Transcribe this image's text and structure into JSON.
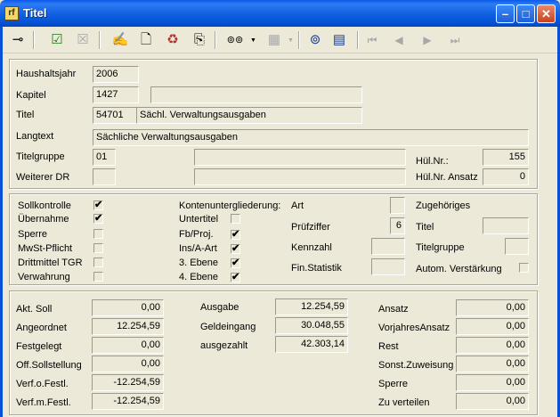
{
  "window": {
    "title": "Titel",
    "icon_text": "rf"
  },
  "toolbar": {
    "items": [
      {
        "name": "pin-icon",
        "glyph": "⊸"
      },
      {
        "name": "check-save-icon",
        "glyph": "☑"
      },
      {
        "name": "cancel-icon",
        "glyph": "☒"
      },
      {
        "name": "hand-sign-icon",
        "glyph": "✍"
      },
      {
        "name": "new-document-icon",
        "glyph": "🗋"
      },
      {
        "name": "recycle-bin-icon",
        "glyph": "♻"
      },
      {
        "name": "copy-document-icon",
        "glyph": "⎘"
      },
      {
        "name": "binoculars-icon",
        "glyph": "⊚⊚"
      },
      {
        "name": "grid-icon",
        "glyph": "▦"
      },
      {
        "name": "binoculars-table-icon",
        "glyph": "⊚"
      },
      {
        "name": "table-icon",
        "glyph": "▤"
      },
      {
        "name": "first-record-icon",
        "glyph": "⏮"
      },
      {
        "name": "prev-record-icon",
        "glyph": "◀"
      },
      {
        "name": "next-record-icon",
        "glyph": "▶"
      },
      {
        "name": "last-record-icon",
        "glyph": "⏭"
      }
    ]
  },
  "header": {
    "haushaltsjahr": {
      "label": "Haushaltsjahr",
      "value": "2006"
    },
    "kapitel": {
      "label": "Kapitel",
      "value": "1427",
      "text": ""
    },
    "titel": {
      "label": "Titel",
      "value": "54701",
      "text": "Sächl. Verwaltungsausgaben"
    },
    "langtext": {
      "label": "Langtext",
      "value": "Sächliche Verwaltungsausgaben"
    },
    "titelgruppe": {
      "label": "Titelgruppe",
      "value": "01",
      "text": ""
    },
    "weiterer_dr": {
      "label": "Weiterer DR",
      "value": "",
      "text": ""
    },
    "hul_nr": {
      "label": "Hül.Nr.:",
      "value": "155"
    },
    "hul_nr_ansatz": {
      "label": "Hül.Nr. Ansatz",
      "value": "0"
    }
  },
  "checks": {
    "col1": [
      {
        "label": "Sollkontrolle",
        "checked": "✔"
      },
      {
        "label": "Übernahme",
        "checked": "✔"
      },
      {
        "label": "Sperre",
        "checked": ""
      },
      {
        "label": "MwSt-Pflicht",
        "checked": ""
      },
      {
        "label": "Drittmittel TGR",
        "checked": ""
      },
      {
        "label": "Verwahrung",
        "checked": ""
      }
    ],
    "konten_label": "Kontenuntergliederung:",
    "col2": [
      {
        "label": "Untertitel",
        "checked": ""
      },
      {
        "label": "Fb/Proj.",
        "checked": "✔"
      },
      {
        "label": "Ins/A-Art",
        "checked": "✔"
      },
      {
        "label": "3. Ebene",
        "checked": "✔"
      },
      {
        "label": "4. Ebene",
        "checked": "✔"
      }
    ],
    "art": {
      "label": "Art",
      "value": ""
    },
    "pruefziffer": {
      "label": "Prüfziffer",
      "value": "6"
    },
    "kennzahl": {
      "label": "Kennzahl",
      "value": ""
    },
    "fin_statistik": {
      "label": "Fin.Statistik",
      "value": ""
    },
    "zugehoeriges": {
      "label": "Zugehöriges"
    },
    "zug_titel": {
      "label": "Titel",
      "value": ""
    },
    "zug_titelgruppe": {
      "label": "Titelgruppe",
      "value": ""
    },
    "autom_verstaerkung": {
      "label": "Autom. Verstärkung",
      "checked": ""
    }
  },
  "amounts": {
    "col1": [
      {
        "label": "Akt. Soll",
        "value": "0,00"
      },
      {
        "label": "Angeordnet",
        "value": "12.254,59"
      },
      {
        "label": "Festgelegt",
        "value": "0,00"
      },
      {
        "label": "Off.Sollstellung",
        "value": "0,00"
      },
      {
        "label": "Verf.o.Festl.",
        "value": "-12.254,59"
      },
      {
        "label": "Verf.m.Festl.",
        "value": "-12.254,59"
      }
    ],
    "col2": [
      {
        "label": "Ausgabe",
        "value": "12.254,59"
      },
      {
        "label": "Geldeingang",
        "value": "30.048,55"
      },
      {
        "label": "ausgezahlt",
        "value": "42.303,14"
      }
    ],
    "col3": [
      {
        "label": "Ansatz",
        "value": "0,00"
      },
      {
        "label": "VorjahresAnsatz",
        "value": "0,00"
      },
      {
        "label": "Rest",
        "value": "0,00"
      },
      {
        "label": "Sonst.Zuweisung",
        "value": "0,00"
      },
      {
        "label": "Sperre",
        "value": "0,00"
      },
      {
        "label": "Zu verteilen",
        "value": "0,00"
      }
    ]
  }
}
